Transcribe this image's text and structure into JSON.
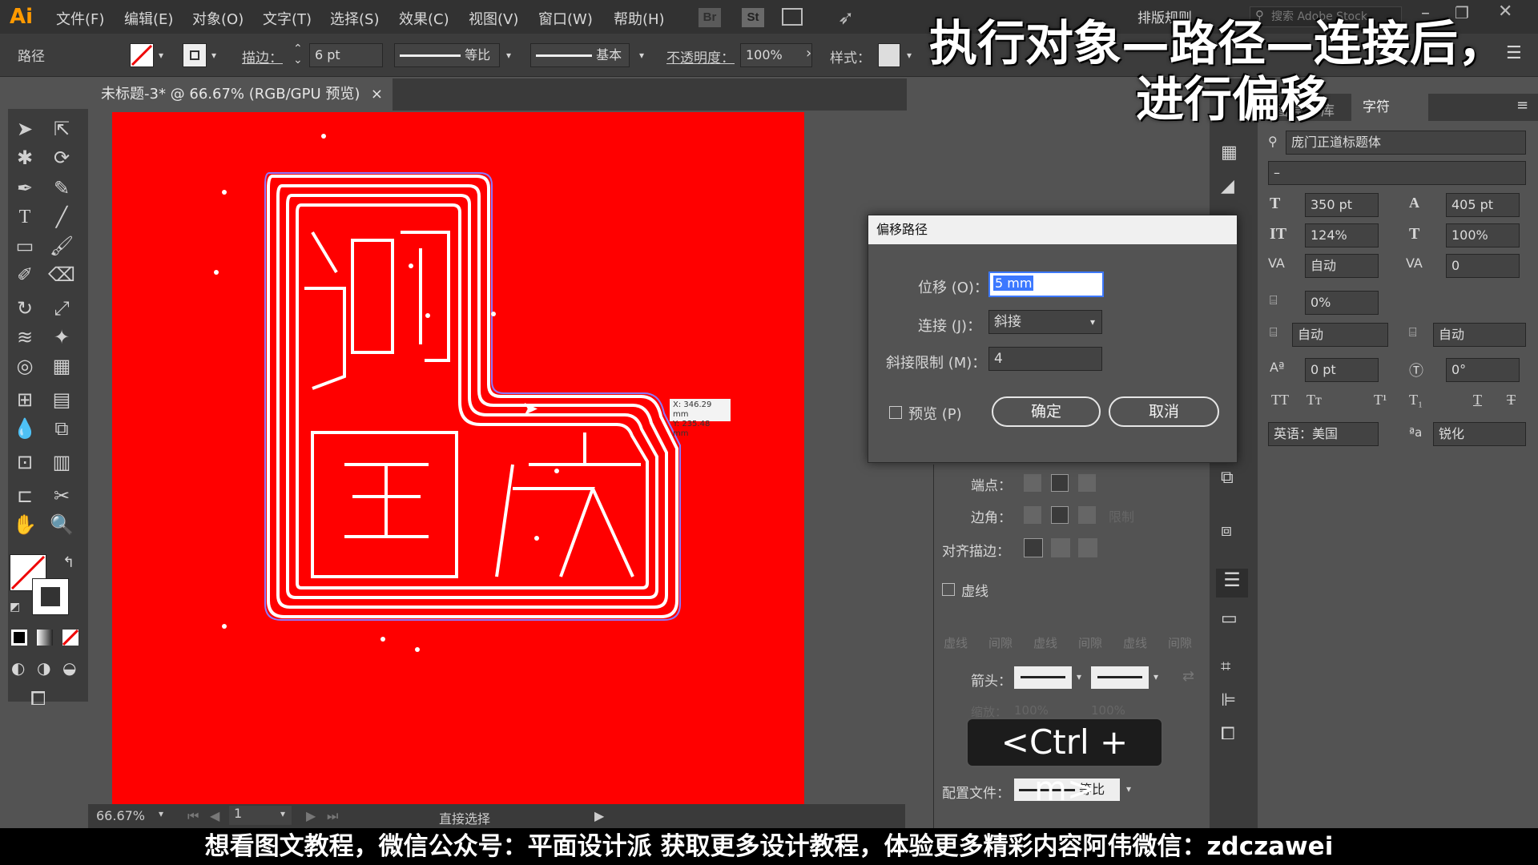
{
  "app": {
    "logo": "Ai"
  },
  "menus": [
    "文件(F)",
    "编辑(E)",
    "对象(O)",
    "文字(T)",
    "选择(S)",
    "效果(C)",
    "视图(V)",
    "窗口(W)",
    "帮助(H)"
  ],
  "topbar": {
    "br": "Br",
    "st": "St",
    "workspace": "排版规则",
    "search_placeholder": "搜索 Adobe Stock"
  },
  "control": {
    "selection_label": "路径",
    "stroke_label": "描边：",
    "stroke_value": "6 pt",
    "profile_label": "等比",
    "brush_label": "基本",
    "opacity_label": "不透明度：",
    "opacity_value": "100%",
    "style_label": "样式："
  },
  "document": {
    "tab_title": "未标题-3* @ 66.67% (RGB/GPU 预览)",
    "close": "×"
  },
  "artwork": {
    "chars": [
      "迎",
      "国",
      "庆"
    ],
    "coords_x": "X: 346.29 mm",
    "coords_y": "Y: 235.48 mm"
  },
  "dialog": {
    "title": "偏移路径",
    "offset_label": "位移 (O)：",
    "offset_value": "5 mm",
    "join_label": "连接 (J)：",
    "join_value": "斜接",
    "miter_label": "斜接限制 (M)：",
    "miter_value": "4",
    "preview_label": "预览 (P)",
    "ok": "确定",
    "cancel": "取消"
  },
  "stroke_panel": {
    "cap_label": "端点：",
    "corner_label": "边角：",
    "limit_label": "限制",
    "align_label": "对齐描边：",
    "dashed_label": "虚线",
    "dash_cols": [
      "虚线",
      "间隙",
      "虚线",
      "间隙",
      "虚线",
      "间隙"
    ],
    "arrow_label": "箭头：",
    "scale_label": "缩放：",
    "scale_a": "100%",
    "scale_b": "100%",
    "profile_label": "配置文件：",
    "profile_value": "等比"
  },
  "char_panel": {
    "tabs": [
      "图层",
      "库",
      "字符"
    ],
    "font_family": "庞门正道标题体",
    "font_style": "–",
    "font_size": "350 pt",
    "leading": "405 pt",
    "v_scale": "124%",
    "h_scale": "100%",
    "kerning": "自动",
    "tracking": "0",
    "tsume": "0%",
    "aki_left": "自动",
    "aki_right": "自动",
    "baseline": "0 pt",
    "rotation": "0°",
    "language": "英语：美国",
    "antialias": "锐化",
    "aa_icon": "ªa"
  },
  "status": {
    "zoom": "66.67%",
    "page": "1",
    "tool": "直接选择"
  },
  "overlay": {
    "caption_line1": "执行对象—路径—连接后，",
    "caption_line2": "进行偏移",
    "shortcut": "<Ctrl + m>",
    "footer": "想看图文教程，微信公众号：平面设计派  获取更多设计教程，体验更多精彩内容阿伟微信：zdczawei"
  },
  "colors": {
    "artboard": "#ff0000",
    "accent": "#3c78ff",
    "dialog_bg": "#535353"
  }
}
